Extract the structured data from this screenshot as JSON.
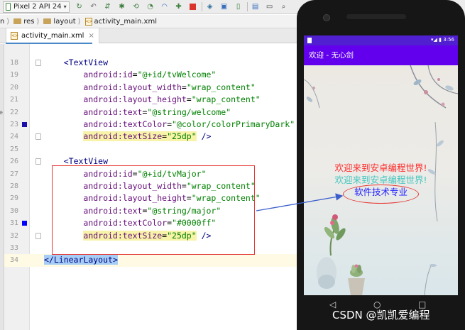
{
  "toolbar": {
    "device": "Pixel 2 API 24",
    "icons": [
      "sync-icon",
      "back-arrow-icon",
      "sync-project-icon",
      "debug-bug-icon",
      "apply-changes-icon",
      "apply-code-icon",
      "profile-icon",
      "attach-debugger-icon",
      "stop-icon",
      "gradle-icon",
      "layout-inspector-icon",
      "avd-manager-icon",
      "sdk-manager-icon",
      "terminal-icon",
      "search-icon"
    ]
  },
  "breadcrumb": [
    "n",
    "res",
    "layout",
    "activity_main.xml"
  ],
  "tab": {
    "label": "activity_main.xml",
    "close": "×"
  },
  "left_strip_char": "e",
  "editor": {
    "lines": [
      {
        "num": "18",
        "parts": [
          {
            "t": "    "
          },
          {
            "c": "punct",
            "t": "<"
          },
          {
            "c": "tag",
            "t": "TextView"
          }
        ]
      },
      {
        "num": "19",
        "parts": [
          {
            "t": "        "
          },
          {
            "c": "attr",
            "t": "android:id"
          },
          {
            "t": "="
          },
          {
            "c": "val",
            "t": "\"@+id/tvWelcome\""
          }
        ]
      },
      {
        "num": "20",
        "parts": [
          {
            "t": "        "
          },
          {
            "c": "attr",
            "t": "android:layout_width"
          },
          {
            "t": "="
          },
          {
            "c": "val",
            "t": "\"wrap_content\""
          }
        ]
      },
      {
        "num": "21",
        "parts": [
          {
            "t": "        "
          },
          {
            "c": "attr",
            "t": "android:layout_height"
          },
          {
            "t": "="
          },
          {
            "c": "val",
            "t": "\"wrap_content\""
          }
        ]
      },
      {
        "num": "22",
        "parts": [
          {
            "t": "        "
          },
          {
            "c": "attr",
            "t": "android:text"
          },
          {
            "t": "="
          },
          {
            "c": "val",
            "t": "\"@string/welcome\""
          }
        ]
      },
      {
        "num": "23",
        "parts": [
          {
            "t": "        "
          },
          {
            "c": "attr",
            "t": "android:textColor"
          },
          {
            "t": "="
          },
          {
            "c": "val",
            "t": "\"@color/colorPrimaryDark\""
          }
        ]
      },
      {
        "num": "24",
        "parts": [
          {
            "t": "        "
          },
          {
            "c": "attr hl",
            "t": "android:textSize"
          },
          {
            "c": "hl",
            "t": "="
          },
          {
            "c": "val hl",
            "t": "\"25dp\""
          },
          {
            "t": " "
          },
          {
            "c": "punct",
            "t": "/>"
          }
        ]
      },
      {
        "num": "25",
        "parts": []
      },
      {
        "num": "26",
        "parts": [
          {
            "t": "    "
          },
          {
            "c": "punct",
            "t": "<"
          },
          {
            "c": "tag",
            "t": "TextView"
          }
        ]
      },
      {
        "num": "27",
        "parts": [
          {
            "t": "        "
          },
          {
            "c": "attr",
            "t": "android:id"
          },
          {
            "t": "="
          },
          {
            "c": "val",
            "t": "\"@+id/tvMajor\""
          }
        ]
      },
      {
        "num": "28",
        "parts": [
          {
            "t": "        "
          },
          {
            "c": "attr",
            "t": "android:layout_width"
          },
          {
            "t": "="
          },
          {
            "c": "val",
            "t": "\"wrap_content\""
          }
        ]
      },
      {
        "num": "29",
        "parts": [
          {
            "t": "        "
          },
          {
            "c": "attr",
            "t": "android:layout_height"
          },
          {
            "t": "="
          },
          {
            "c": "val",
            "t": "\"wrap_content\""
          }
        ]
      },
      {
        "num": "30",
        "parts": [
          {
            "t": "        "
          },
          {
            "c": "attr",
            "t": "android:text"
          },
          {
            "t": "="
          },
          {
            "c": "val",
            "t": "\"@string/major\""
          }
        ]
      },
      {
        "num": "31",
        "parts": [
          {
            "t": "        "
          },
          {
            "c": "attr",
            "t": "android:textColor"
          },
          {
            "t": "="
          },
          {
            "c": "val",
            "t": "\"#0000ff\""
          }
        ]
      },
      {
        "num": "32",
        "parts": [
          {
            "t": "        "
          },
          {
            "c": "attr hl",
            "t": "android:textSize"
          },
          {
            "c": "hl",
            "t": "="
          },
          {
            "c": "val hl",
            "t": "\"25dp\""
          },
          {
            "t": " "
          },
          {
            "c": "punct",
            "t": "/>"
          }
        ]
      },
      {
        "num": "33",
        "parts": []
      },
      {
        "num": "34",
        "parts": [
          {
            "c": "punct sel",
            "t": "</"
          },
          {
            "c": "tag sel",
            "t": "LinearLayout"
          },
          {
            "c": "punct sel",
            "t": ">"
          }
        ]
      }
    ],
    "color_markers": {
      "23": "#1a0dab",
      "31": "#0000ff"
    }
  },
  "phone": {
    "status_time": "3:56",
    "status_icons": "▾◢ ▮",
    "app_title": "欢迎 - 无心剑",
    "welcome_1": "欢迎来到安卓编程世界!",
    "welcome_2": "欢迎来到安卓编程世界!",
    "major": "软件技术专业",
    "nav": {
      "back": "◁",
      "home": "○",
      "recents": "□"
    },
    "colors": {
      "statusbar": "#4f1fd0",
      "appbar": "#6200ee",
      "welcome": "#ff2a2a",
      "welcome_shadow": "#45c7bf",
      "major": "#2020ff"
    }
  },
  "watermark": "CSDN @凯凯爱编程"
}
